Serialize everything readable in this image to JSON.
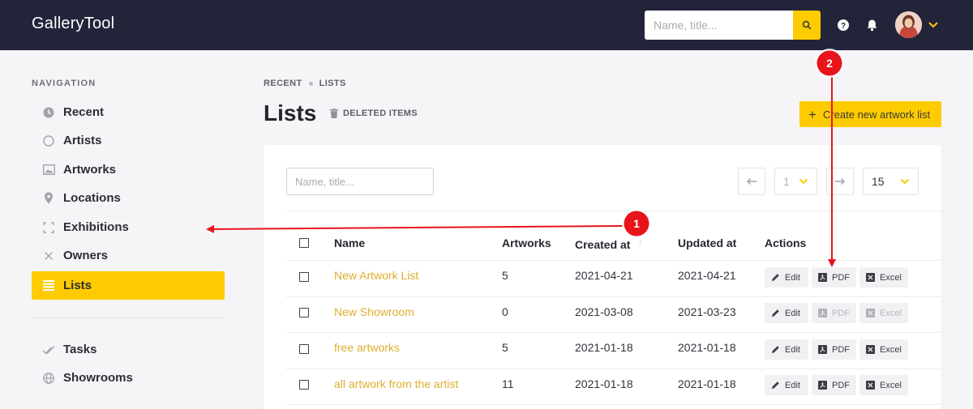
{
  "app": {
    "name": "GalleryTool",
    "search_placeholder": "Name, title...",
    "accent_color": "#fdcb00",
    "topbar_color": "#22243a"
  },
  "topbar_icons": [
    "search-icon",
    "help-icon",
    "bell-icon",
    "chevron-down-icon"
  ],
  "navigation": {
    "title": "NAVIGATION",
    "items": [
      {
        "label": "Recent",
        "icon": "clock-icon"
      },
      {
        "label": "Artists",
        "icon": "circle-icon"
      },
      {
        "label": "Artworks",
        "icon": "image-icon"
      },
      {
        "label": "Locations",
        "icon": "pin-icon"
      },
      {
        "label": "Exhibitions",
        "icon": "frame-icon"
      },
      {
        "label": "Owners",
        "icon": "x-icon"
      },
      {
        "label": "Lists",
        "icon": "list-icon",
        "active": true
      }
    ],
    "secondary": [
      {
        "label": "Tasks",
        "icon": "check-icon"
      },
      {
        "label": "Showrooms",
        "icon": "globe-icon"
      }
    ]
  },
  "breadcrumb": [
    "RECENT",
    "LISTS"
  ],
  "page": {
    "title": "Lists",
    "deleted_label": "DELETED ITEMS",
    "create_label": "Create new artwork list"
  },
  "toolbar": {
    "filter_placeholder": "Name, title...",
    "page": "1",
    "per_page": "15"
  },
  "table": {
    "columns": [
      "Name",
      "Artworks",
      "Created at",
      "Updated at",
      "Actions"
    ],
    "rows": [
      {
        "name": "New Artwork List",
        "artworks": "5",
        "created": "2021-04-21",
        "updated": "2021-04-21",
        "export_enabled": true
      },
      {
        "name": "New Showroom",
        "artworks": "0",
        "created": "2021-03-08",
        "updated": "2021-03-23",
        "export_enabled": false
      },
      {
        "name": "free artworks",
        "artworks": "5",
        "created": "2021-01-18",
        "updated": "2021-01-18",
        "export_enabled": true
      },
      {
        "name": "all artwork from the artist",
        "artworks": "11",
        "created": "2021-01-18",
        "updated": "2021-01-18",
        "export_enabled": true
      }
    ],
    "actions": [
      "Edit",
      "PDF",
      "Excel"
    ]
  },
  "annotations": {
    "markers": [
      "1",
      "2"
    ],
    "color": "#e8141b"
  }
}
